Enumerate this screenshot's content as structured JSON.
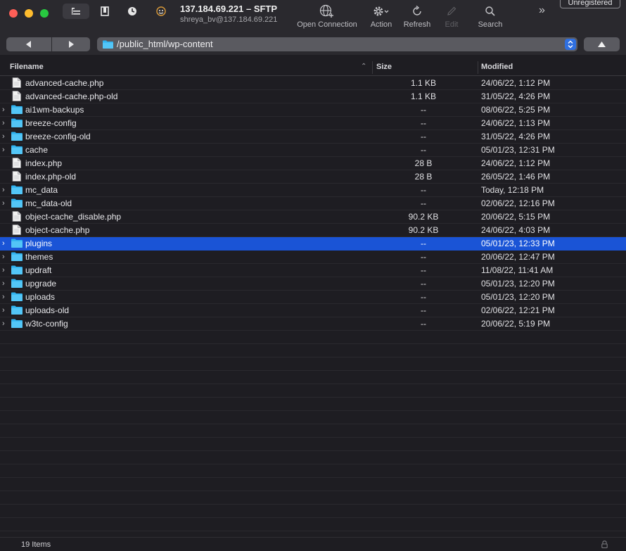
{
  "window": {
    "title": "137.184.69.221 – SFTP",
    "subtitle": "shreya_bv@137.184.69.221",
    "unregistered_badge": "Unregistered"
  },
  "toolbar": {
    "open_connection": "Open Connection",
    "action": "Action",
    "refresh": "Refresh",
    "edit": "Edit",
    "search": "Search",
    "more": "»"
  },
  "path": {
    "current": "/public_html/wp-content"
  },
  "table": {
    "columns": {
      "filename": "Filename",
      "size": "Size",
      "modified": "Modified"
    },
    "rows": [
      {
        "type": "file",
        "name": "advanced-cache.php",
        "size": "1.1 KB",
        "modified": "24/06/22, 1:12 PM"
      },
      {
        "type": "file",
        "name": "advanced-cache.php-old",
        "size": "1.1 KB",
        "modified": "31/05/22, 4:26 PM"
      },
      {
        "type": "folder",
        "name": "ai1wm-backups",
        "size": "--",
        "modified": "08/06/22, 5:25 PM"
      },
      {
        "type": "folder",
        "name": "breeze-config",
        "size": "--",
        "modified": "24/06/22, 1:13 PM"
      },
      {
        "type": "folder",
        "name": "breeze-config-old",
        "size": "--",
        "modified": "31/05/22, 4:26 PM"
      },
      {
        "type": "folder",
        "name": "cache",
        "size": "--",
        "modified": "05/01/23, 12:31 PM"
      },
      {
        "type": "file",
        "name": "index.php",
        "size": "28 B",
        "modified": "24/06/22, 1:12 PM"
      },
      {
        "type": "file",
        "name": "index.php-old",
        "size": "28 B",
        "modified": "26/05/22, 1:46 PM"
      },
      {
        "type": "folder",
        "name": "mc_data",
        "size": "--",
        "modified": "Today, 12:18 PM"
      },
      {
        "type": "folder",
        "name": "mc_data-old",
        "size": "--",
        "modified": "02/06/22, 12:16 PM"
      },
      {
        "type": "file",
        "name": "object-cache_disable.php",
        "size": "90.2 KB",
        "modified": "20/06/22, 5:15 PM"
      },
      {
        "type": "file",
        "name": "object-cache.php",
        "size": "90.2 KB",
        "modified": "24/06/22, 4:03 PM"
      },
      {
        "type": "folder",
        "name": "plugins",
        "size": "--",
        "modified": "05/01/23, 12:33 PM",
        "selected": true
      },
      {
        "type": "folder",
        "name": "themes",
        "size": "--",
        "modified": "20/06/22, 12:47 PM"
      },
      {
        "type": "folder",
        "name": "updraft",
        "size": "--",
        "modified": "11/08/22, 11:41 AM"
      },
      {
        "type": "folder",
        "name": "upgrade",
        "size": "--",
        "modified": "05/01/23, 12:20 PM"
      },
      {
        "type": "folder",
        "name": "uploads",
        "size": "--",
        "modified": "05/01/23, 12:20 PM"
      },
      {
        "type": "folder",
        "name": "uploads-old",
        "size": "--",
        "modified": "02/06/22, 12:21 PM"
      },
      {
        "type": "folder",
        "name": "w3tc-config",
        "size": "--",
        "modified": "20/06/22, 5:19 PM"
      }
    ]
  },
  "status": {
    "items_count": "19 Items"
  },
  "colors": {
    "selection": "#1a54d6",
    "folder": "#2fb3f0",
    "background": "#1e1d22"
  }
}
